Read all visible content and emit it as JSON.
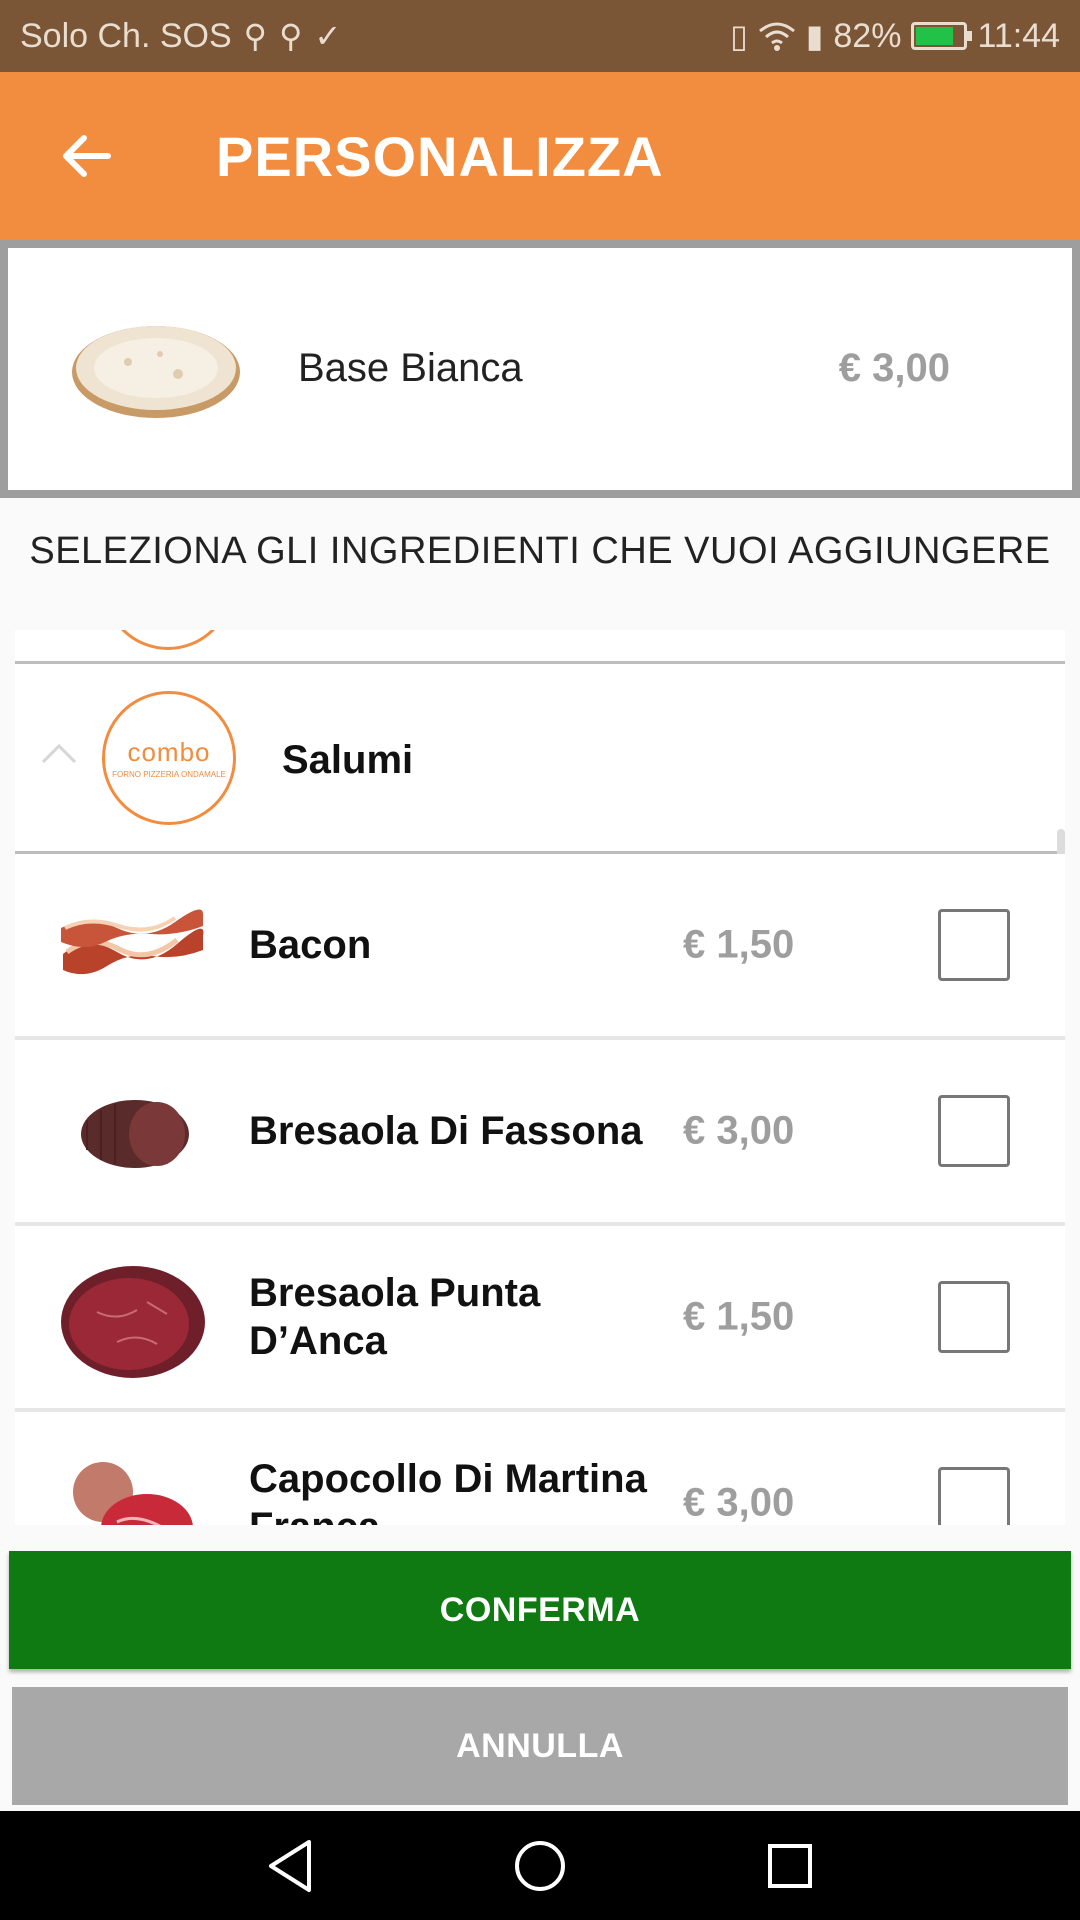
{
  "status_bar": {
    "carrier": "Solo Ch. SOS",
    "battery": "82%",
    "battery_level": 0.82,
    "time": "11:44",
    "colors": {
      "background": "#7a5536",
      "battery_fill": "#22c248"
    }
  },
  "app_bar": {
    "title": "PERSONALIZZA",
    "back_icon": "arrow-back-icon",
    "color": "#f28c3e"
  },
  "product": {
    "name": "Base Bianca",
    "price": "€ 3,00",
    "image": "pizza-base-image"
  },
  "instructions": "SELEZIONA GLI INGREDIENTI CHE VUOI AGGIUNGERE",
  "category": {
    "name": "Salumi",
    "logo_text": "combo",
    "logo_subtext": "FORNO PIZZERIA ONDAMALE",
    "chevron_icon": "chevron-up-icon"
  },
  "ingredients": [
    {
      "name": "Bacon",
      "price": "€ 1,50",
      "checked": false,
      "image": "bacon-image"
    },
    {
      "name": "Bresaola Di Fassona",
      "price": "€ 3,00",
      "checked": false,
      "image": "bresaola-image"
    },
    {
      "name": "Bresaola Punta D’Anca",
      "price": "€ 1,50",
      "checked": false,
      "image": "bresaola-punta-image"
    },
    {
      "name": "Capocollo Di Martina Franca",
      "price": "€ 3,00",
      "checked": false,
      "image": "capocollo-image"
    }
  ],
  "buttons": {
    "confirm": "CONFERMA",
    "cancel": "ANNULLA",
    "confirm_color": "#0f7a12",
    "cancel_color": "#a8a8a8"
  },
  "nav_bar": {
    "back_icon": "nav-back-icon",
    "home_icon": "nav-home-icon",
    "recents_icon": "nav-recents-icon"
  }
}
